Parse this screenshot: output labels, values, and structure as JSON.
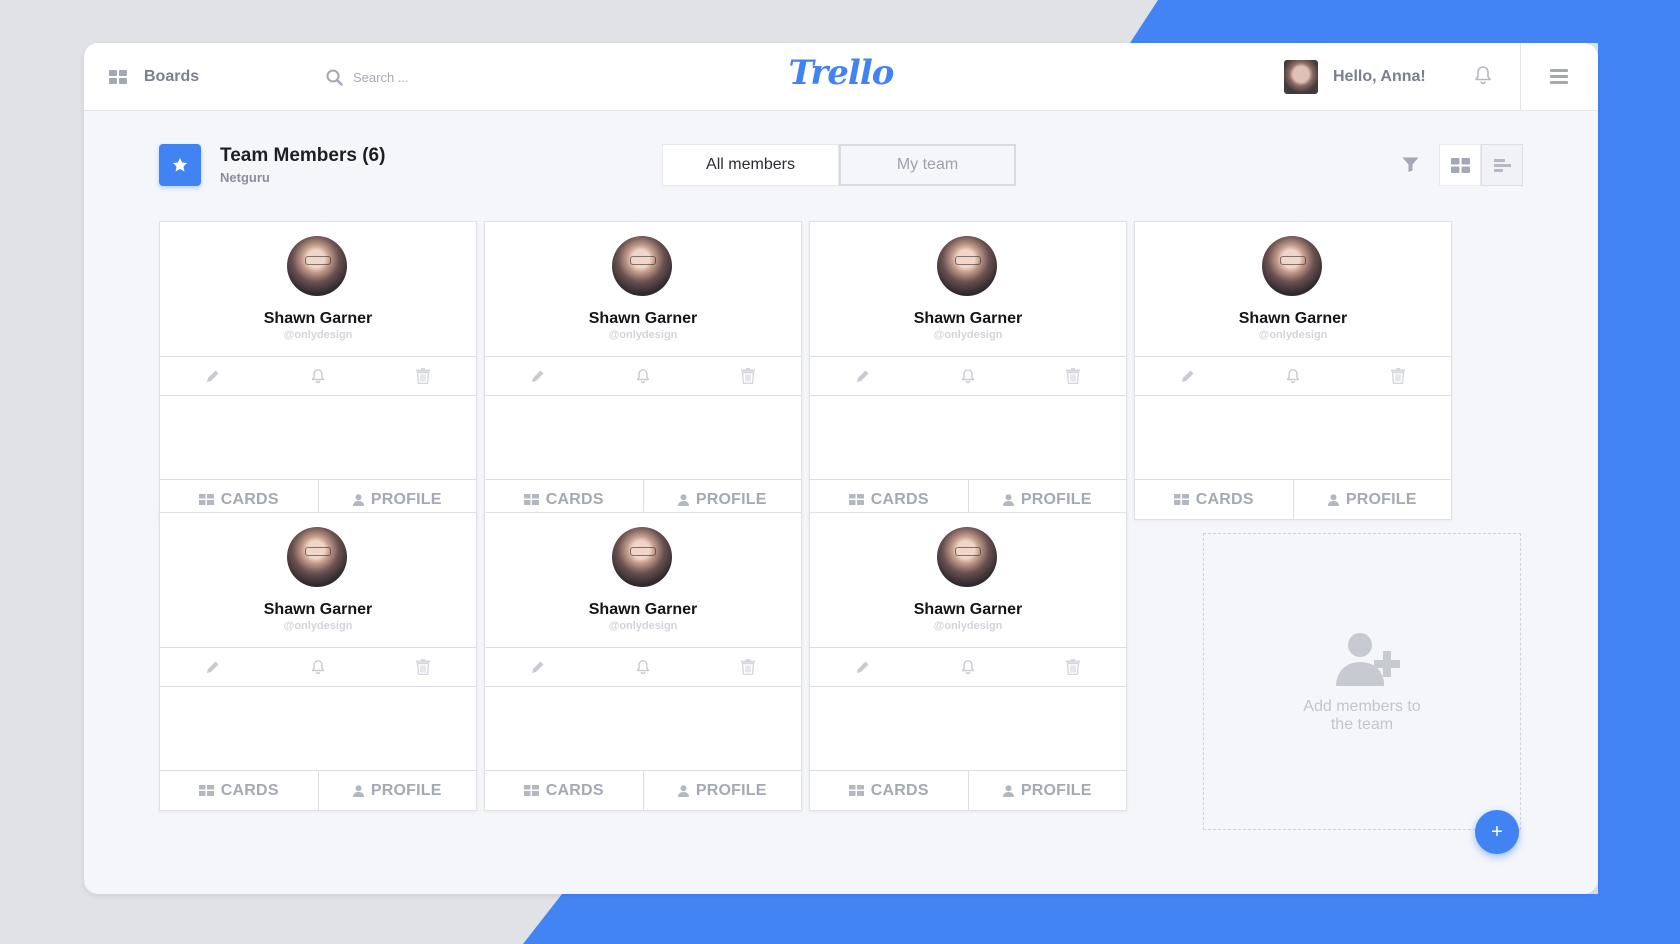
{
  "topbar": {
    "boards_label": "Boards",
    "search_placeholder": "Search ...",
    "logo_text": "Trello",
    "greeting": "Hello, Anna!"
  },
  "header": {
    "title": "Team Members (6)",
    "subtitle": "Netguru",
    "tabs": [
      {
        "label": "All members",
        "active": true
      },
      {
        "label": "My team",
        "active": false
      }
    ]
  },
  "members": [
    {
      "name": "Shawn Garner",
      "handle": "@onlydesign",
      "cards_label": "CARDS",
      "profile_label": "PROFILE"
    },
    {
      "name": "Shawn Garner",
      "handle": "@onlydesign",
      "cards_label": "CARDS",
      "profile_label": "PROFILE"
    },
    {
      "name": "Shawn Garner",
      "handle": "@onlydesign",
      "cards_label": "CARDS",
      "profile_label": "PROFILE"
    },
    {
      "name": "Shawn Garner",
      "handle": "@onlydesign",
      "cards_label": "CARDS",
      "profile_label": "PROFILE"
    },
    {
      "name": "Shawn Garner",
      "handle": "@onlydesign",
      "cards_label": "CARDS",
      "profile_label": "PROFILE"
    },
    {
      "name": "Shawn Garner",
      "handle": "@onlydesign",
      "cards_label": "CARDS",
      "profile_label": "PROFILE"
    },
    {
      "name": "Shawn Garner",
      "handle": "@onlydesign",
      "cards_label": "CARDS",
      "profile_label": "PROFILE"
    }
  ],
  "add_card": {
    "text_line1": "Add members to",
    "text_line2": "the team",
    "fab_label": "+"
  },
  "icons": {
    "boards": "grid-icon",
    "search": "search-icon",
    "notifications": "bell-icon",
    "menu": "hamburger-icon",
    "title": "star-icon",
    "filter": "filter-icon",
    "view_grid": "grid-view-icon",
    "view_list": "list-view-icon",
    "edit": "pencil-icon",
    "notify": "bell-icon",
    "delete": "trash-icon",
    "cards": "cards-icon",
    "profile": "user-icon",
    "add_member": "add-user-icon"
  },
  "colors": {
    "accent": "#4283f4",
    "background": "#f5f6fa",
    "muted": "#a4a9b3"
  }
}
